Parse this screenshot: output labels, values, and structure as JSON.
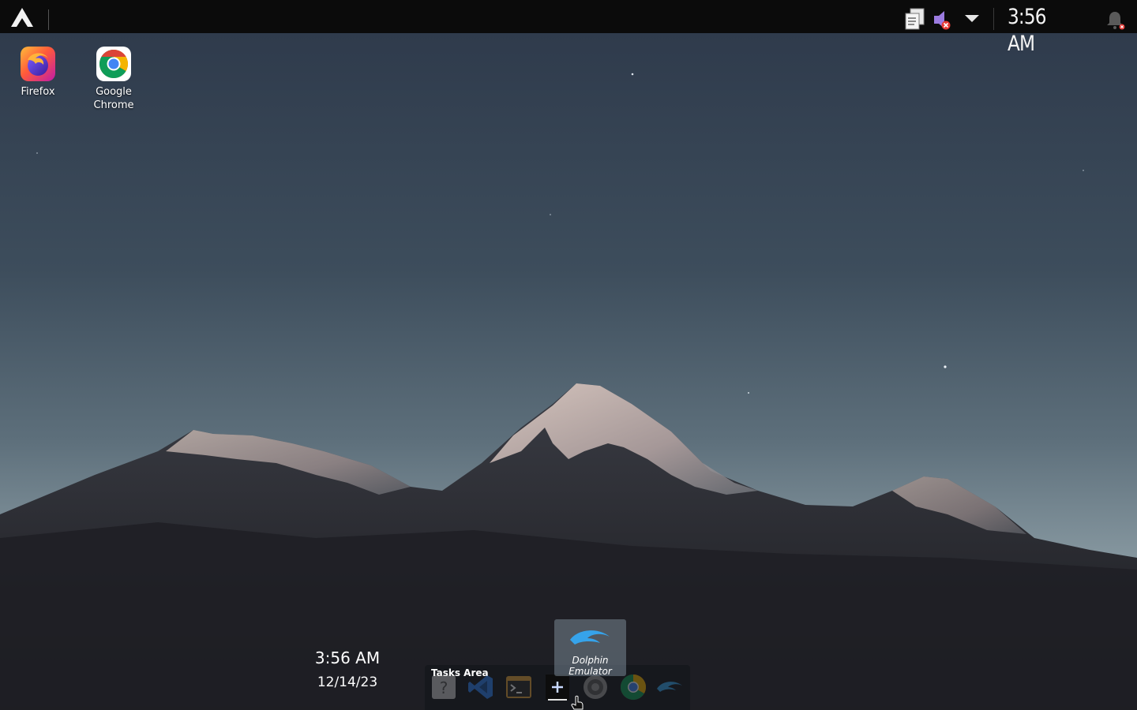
{
  "top_panel": {
    "clock": "3:56 AM",
    "icons": [
      "arch-logo-icon",
      "clipboard-icon",
      "volume-muted-icon",
      "chevron-down-icon",
      "notification-bell-icon"
    ]
  },
  "desktop": {
    "icons": [
      {
        "label": "Firefox",
        "icon": "firefox-icon"
      },
      {
        "label": "Google Chrome",
        "icon": "chrome-icon"
      }
    ],
    "widget": {
      "time": "3:56 AM",
      "date": "12/14/23"
    }
  },
  "dock": {
    "title": "Tasks Area",
    "items": [
      {
        "name": "unknown-app-icon"
      },
      {
        "name": "vscode-icon"
      },
      {
        "name": "terminal-icon"
      },
      {
        "name": "add-task-icon"
      },
      {
        "name": "settings-icon"
      },
      {
        "name": "chrome-icon"
      },
      {
        "name": "dolphin-emulator-icon"
      }
    ],
    "tooltip": "Dolphin Emulator"
  },
  "colors": {
    "panel_bg": "#0b0b0b",
    "accent_chrome_blue": "#4285f4",
    "dolphin_blue": "#36a3ea"
  }
}
